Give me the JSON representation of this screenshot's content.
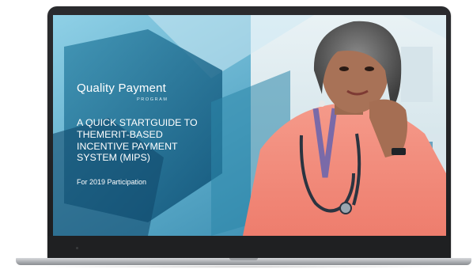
{
  "slide": {
    "brand_name": "Quality Payment",
    "brand_sub": "PROGRAM",
    "headline_lines": [
      "A QUICK STARTGUIDE  TO",
      "THEMERIT-BASED",
      "INCENTIVE PAYMENT",
      "SYSTEM (MIPS)"
    ],
    "subline": "For 2019 Participation"
  },
  "colors": {
    "accent_blue": "#1d6f8f",
    "sky_blue": "#6fb8d2",
    "bezel": "#1f2022"
  }
}
